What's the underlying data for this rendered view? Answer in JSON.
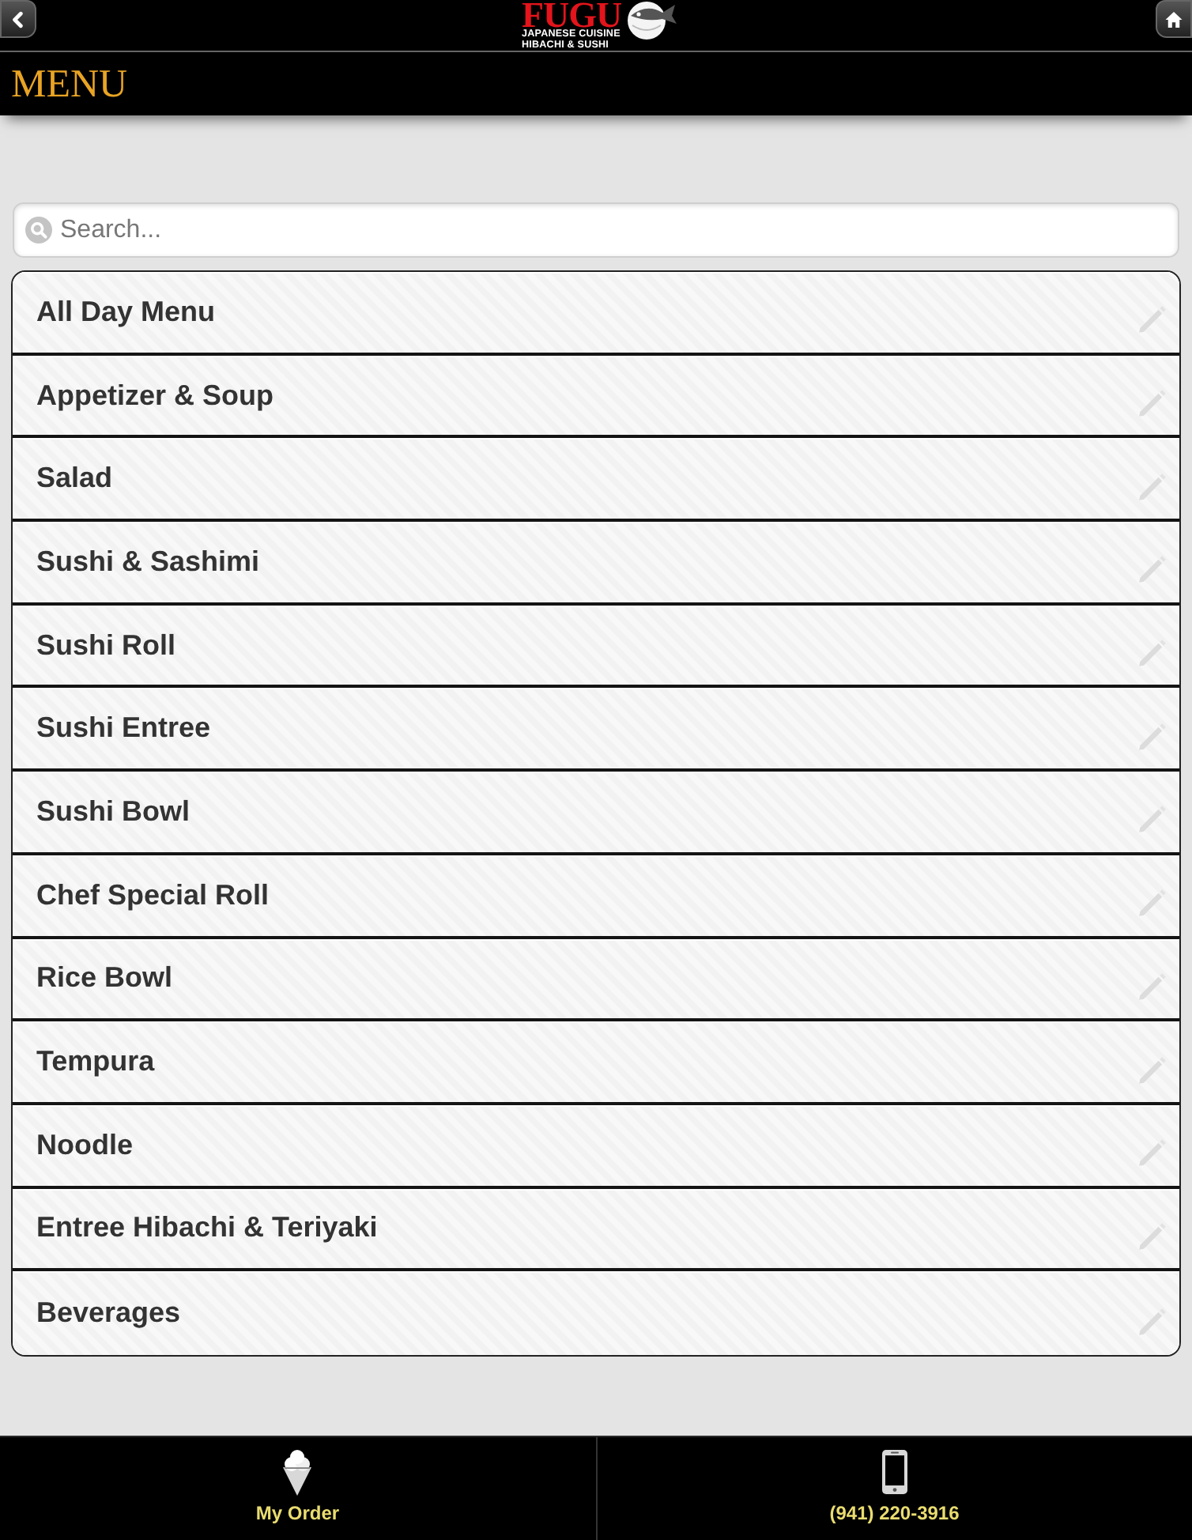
{
  "header": {
    "logo": {
      "name": "FUGU",
      "line_1": "JAPANESE CUISINE",
      "line_2": "HIBACHI & SUSHI"
    }
  },
  "page_title": "MENU",
  "search": {
    "placeholder": "Search..."
  },
  "categories": [
    {
      "label": "All Day Menu"
    },
    {
      "label": "Appetizer & Soup"
    },
    {
      "label": "Salad"
    },
    {
      "label": "Sushi & Sashimi"
    },
    {
      "label": "Sushi Roll"
    },
    {
      "label": "Sushi Entree"
    },
    {
      "label": "Sushi Bowl"
    },
    {
      "label": "Chef Special Roll"
    },
    {
      "label": "Rice Bowl"
    },
    {
      "label": "Tempura"
    },
    {
      "label": "Noodle"
    },
    {
      "label": "Entree Hibachi & Teriyaki"
    },
    {
      "label": "Beverages"
    }
  ],
  "footer": [
    {
      "kind": "order",
      "label": "My Order"
    },
    {
      "kind": "phone",
      "label": "(941) 220-3916"
    }
  ]
}
